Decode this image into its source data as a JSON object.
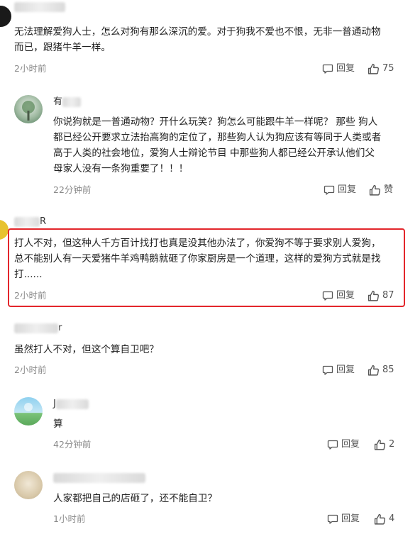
{
  "comments": [
    {
      "text_lines": [
        "无法理解爱狗人士，怎么对狗有那么深沉的爱。对于狗我不爱也不恨，无非一普通动物",
        "而已，跟猪牛羊一样。"
      ],
      "time": "2小时前",
      "reply_label": "回复",
      "like_count": "75"
    },
    {
      "name_visible": "有",
      "text_lines": [
        "你说狗就是一普通动物？开什么玩笑？狗怎么可能跟牛羊一样呢？ 那些 狗人",
        "都已经公开要求立法抬高狗的定位了，那些狗人认为狗应该有等同于人类或者",
        "高于人类的社会地位，爱狗人士辩论节目 中那些狗人都已经公开承认他们父",
        "母家人没有一条狗重要了！！！"
      ],
      "time": "22分钟前",
      "reply_label": "回复",
      "like_label": "赞"
    },
    {
      "name_visible": "R",
      "text_lines": [
        "打人不对，但这种人千方百计找打也真是没其他办法了，你爱狗不等于要求别人爱狗，",
        "总不能别人有一天爱猪牛羊鸡鸭鹅就砸了你家厨房是一个道理，这样的爱狗方式就是找",
        "打......"
      ],
      "time": "2小时前",
      "reply_label": "回复",
      "like_count": "87"
    },
    {
      "name_visible": "r",
      "text_lines": [
        "虽然打人不对，但这个算自卫吧？"
      ],
      "time": "2小时前",
      "reply_label": "回复",
      "like_count": "85"
    },
    {
      "name_visible": "J",
      "text_lines": [
        "算"
      ],
      "time": "42分钟前",
      "reply_label": "回复",
      "like_count": "2"
    },
    {
      "text_lines": [
        "人家都把自己的店砸了，还不能自卫？"
      ],
      "time": "1小时前",
      "reply_label": "回复",
      "like_count": "4"
    }
  ],
  "colors": {
    "highlight_border": "#e3262b",
    "meta_text": "#8a8a8a"
  },
  "icons": {
    "reply": "comment-bubble-icon",
    "like": "thumbs-up-icon"
  }
}
